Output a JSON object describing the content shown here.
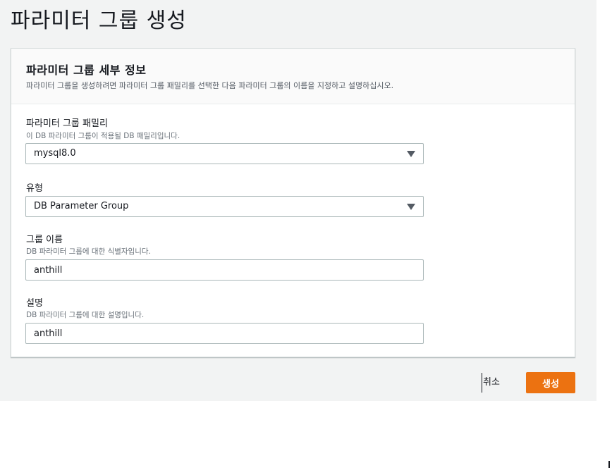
{
  "page": {
    "title": "파라미터 그룹 생성"
  },
  "panel": {
    "heading": "파라미터 그룹 세부 정보",
    "description": "파라미터 그룹을 생성하려면 파라미터 그룹 패밀리를 선택한 다음 파라미터 그룹의 이름을 지정하고 설명하십시오."
  },
  "fields": {
    "family": {
      "label": "파라미터 그룹 패밀리",
      "hint": "이 DB 파라미터 그룹이 적용될 DB 패밀리입니다.",
      "value": "mysql8.0"
    },
    "type": {
      "label": "유형",
      "value": "DB Parameter Group"
    },
    "group_name": {
      "label": "그룹 이름",
      "hint": "DB 파라미터 그룹에 대한 식별자입니다.",
      "value": "anthill"
    },
    "description": {
      "label": "설명",
      "hint": "DB 파라미터 그룹에 대한 설명입니다.",
      "value": "anthill"
    }
  },
  "actions": {
    "cancel_label": "취소",
    "create_label": "생성"
  },
  "colors": {
    "primary_button": "#ec7211",
    "page_background": "#f2f3f3"
  }
}
